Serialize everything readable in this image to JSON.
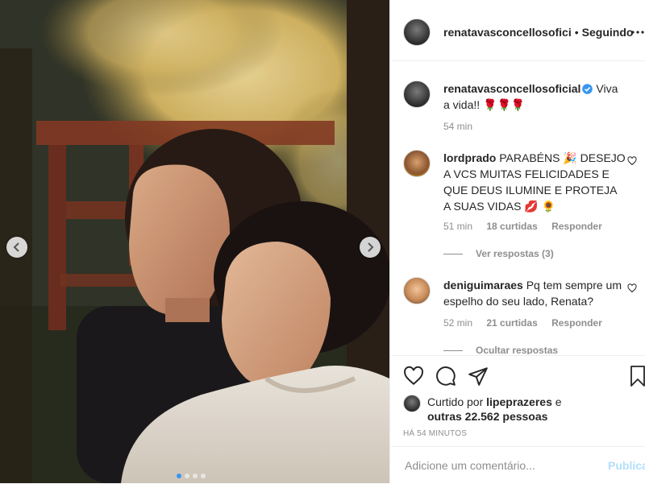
{
  "post": {
    "author": "renatavasconcellosofici",
    "separator": "•",
    "follow_status": "Seguindo"
  },
  "caption": {
    "user": "renatavasconcellosoficial",
    "text": "Viva a vida!! 🌹🌹🌹",
    "time": "54 min"
  },
  "comments": [
    {
      "user": "lordprado",
      "text": "PARABÉNS 🎉 DESEJO A VCS MUITAS FELICIDADES E QUE DEUS ILUMINE E PROTEJA A SUAS VIDAS 💋 🌻",
      "time": "51 min",
      "likes": "18 curtidas",
      "reply_label": "Responder",
      "replies_toggle": "Ver respostas (3)"
    },
    {
      "user": "deniguimaraes",
      "text": "Pq tem sempre um espelho do seu lado, Renata?",
      "time": "52 min",
      "likes": "21 curtidas",
      "reply_label": "Responder",
      "replies_toggle": "Ocultar respostas"
    }
  ],
  "likes": {
    "prefix": "Curtido por",
    "user": "lipeprazeres",
    "connector": "e",
    "others": "outras 22.562 pessoas"
  },
  "timestamp": "HÁ 54 MINUTOS",
  "add_comment": {
    "placeholder": "Adicione um comentário...",
    "publish_label": "Publicar"
  },
  "carousel": {
    "slide_count": 4,
    "active_index": 0
  },
  "icons": {
    "like": "heart-icon",
    "comment": "comment-icon",
    "share": "share-icon",
    "save": "bookmark-icon",
    "more": "more-icon",
    "verified": "verified-badge-icon"
  },
  "colors": {
    "link_blue": "#3897f0",
    "publish_disabled": "#b2dffc",
    "secondary_text": "#8e8e8e",
    "verified_blue": "#3897f0"
  }
}
